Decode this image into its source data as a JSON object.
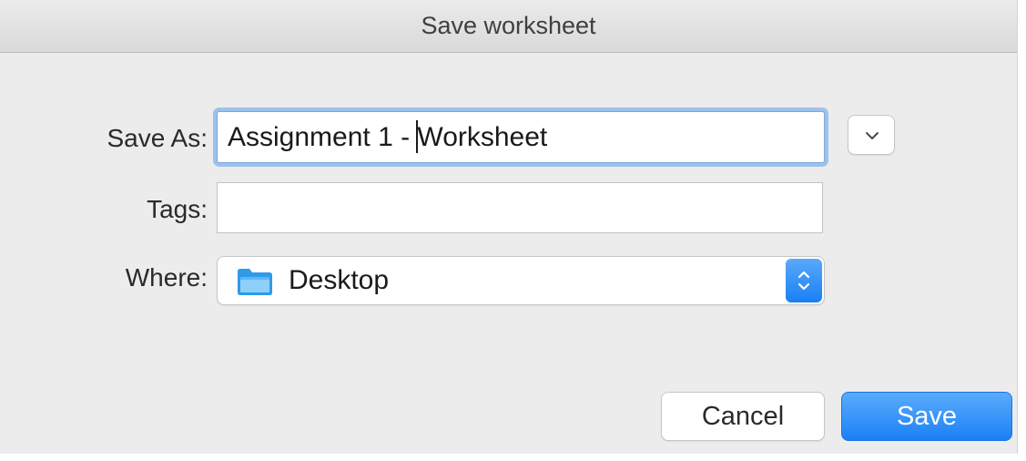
{
  "window": {
    "title": "Save worksheet"
  },
  "form": {
    "save_as": {
      "label": "Save As:",
      "value_before_caret": "Assignment 1 - ",
      "value_after_caret": "Worksheet"
    },
    "tags": {
      "label": "Tags:",
      "value": ""
    },
    "where": {
      "label": "Where:",
      "selected": "Desktop",
      "icon": "folder-icon"
    }
  },
  "buttons": {
    "cancel_label": "Cancel",
    "save_label": "Save"
  },
  "colors": {
    "accent": "#1b80f6",
    "focus_ring": "#9cc1ec",
    "folder": "#3aa6f0",
    "dialog_background": "#ececec"
  }
}
